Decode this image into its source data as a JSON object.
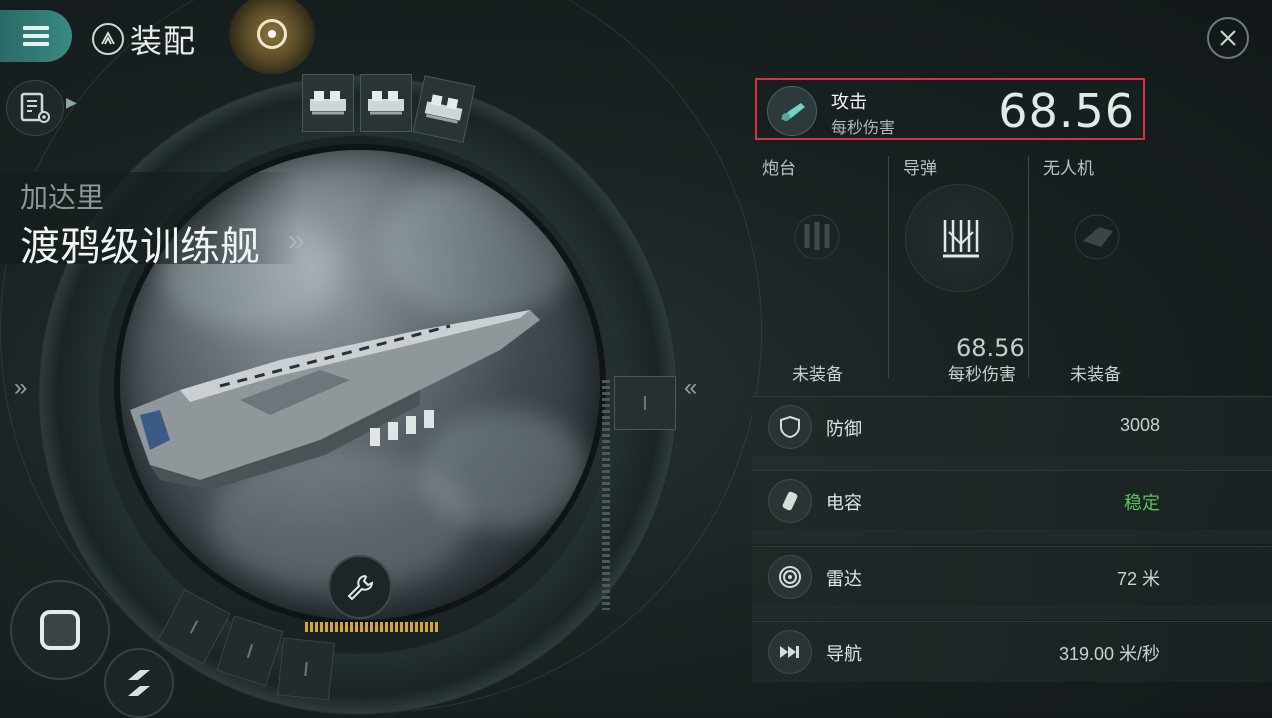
{
  "header": {
    "menu_icon": "hamburger-icon",
    "fit_icon": "ship-fitting-icon",
    "title": "装配",
    "scanner_icon": "scanner-orb-icon",
    "close_icon": "close-icon"
  },
  "ship": {
    "corp": "加达里",
    "name": "渡鸦级训练舰",
    "name_arrow": "»"
  },
  "side": {
    "left_arrow": "»",
    "right_arrow": "«"
  },
  "attack": {
    "label": "攻击",
    "sub": "每秒伤害",
    "value": "68.56"
  },
  "weapons": {
    "turret": {
      "label": "炮台",
      "status": "未装备"
    },
    "missile": {
      "label": "导弹",
      "value": "68.56",
      "sub": "每秒伤害"
    },
    "drone": {
      "label": "无人机",
      "status": "未装备"
    }
  },
  "stats": [
    {
      "label": "防御",
      "value": "3008",
      "icon": "shield-icon"
    },
    {
      "label": "电容",
      "value": "稳定",
      "icon": "capacitor-icon",
      "color": "#5fc05a"
    },
    {
      "label": "雷达",
      "value": "72 米",
      "icon": "radar-icon"
    },
    {
      "label": "导航",
      "value": "319.00 米/秒",
      "icon": "navigation-icon"
    }
  ],
  "colors": {
    "accent_teal": "#3a8a84",
    "highlight_red": "#d8323a",
    "stable_green": "#5fc05a",
    "capacitor_gold": "#d4a73a"
  }
}
